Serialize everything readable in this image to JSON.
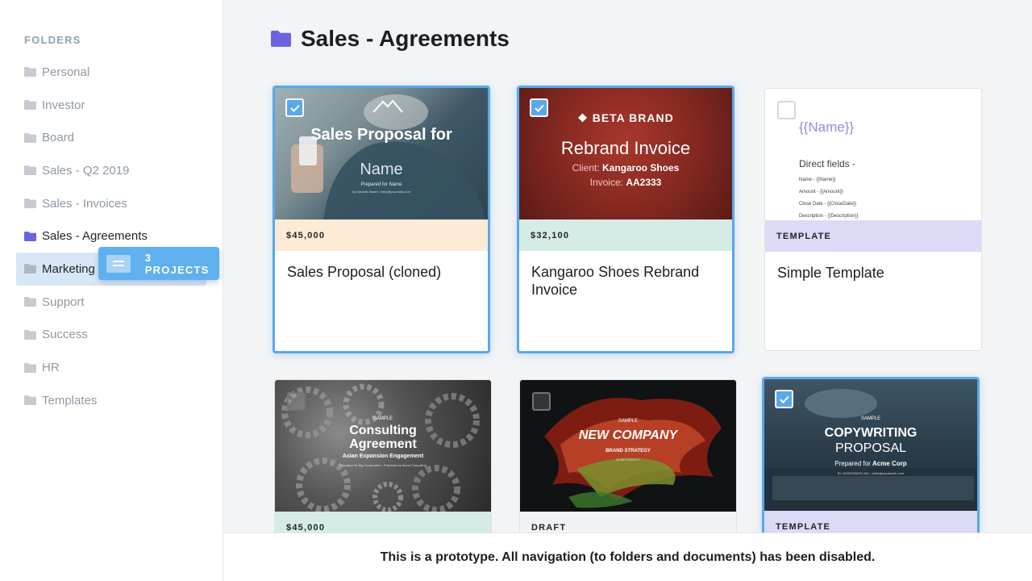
{
  "sidebar": {
    "heading": "FOLDERS",
    "folders": [
      {
        "label": "Personal"
      },
      {
        "label": "Investor"
      },
      {
        "label": "Board"
      },
      {
        "label": "Sales - Q2 2019"
      },
      {
        "label": "Sales - Invoices"
      },
      {
        "label": "Sales - Agreements"
      },
      {
        "label": "Marketing"
      },
      {
        "label": "Support"
      },
      {
        "label": "Success"
      },
      {
        "label": "HR"
      },
      {
        "label": "Templates"
      }
    ],
    "active_folder": "Sales - Agreements",
    "drop_target_folder": "Marketing"
  },
  "drag_badge": {
    "label": "3 PROJECTS"
  },
  "main": {
    "title": "Sales - Agreements",
    "cards": [
      {
        "band": "$45,000",
        "title": "Sales Proposal (cloned)",
        "selected": true,
        "thumb": {
          "line1": "Sales Proposal for",
          "line2": "Name",
          "line3": "Prepared for Name",
          "line4": "by Danielle Baker • hello@proposify.com"
        }
      },
      {
        "band": "$32,100",
        "title": "Kangaroo Shoes Rebrand Invoice",
        "selected": true,
        "thumb": {
          "brand": "BETA BRAND",
          "line1": "Rebrand Invoice",
          "client_label": "Client:",
          "client": "Kangaroo Shoes",
          "invoice_label": "Invoice:",
          "invoice": "AA2333"
        }
      },
      {
        "band": "TEMPLATE",
        "title": "Simple Template",
        "selected": false,
        "thumb": {
          "name_tag": "{{Name}}",
          "heading": "Direct fields -",
          "fields": [
            "Name - {{Name}}",
            "Amount - {{Amount}}",
            "Close Date - {{CloseDate}}",
            "Description - {{Description}}"
          ]
        }
      },
      {
        "band": "$45,000",
        "title": "",
        "selected": false,
        "thumb": {
          "sample": "SAMPLE",
          "line1": "Consulting",
          "line2": "Agreement",
          "line3": "Asian Expansion Engagement",
          "line4": "Prepared for Big Corporation  •  Prepared by Acme Consulting"
        }
      },
      {
        "band": "DRAFT",
        "title": "",
        "selected": false,
        "thumb": {
          "sample": "SAMPLE",
          "line1": "NEW COMPANY",
          "line2": "BRAND STRATEGY",
          "line3": "ACME AGENCY"
        }
      },
      {
        "band": "TEMPLATE",
        "title": "",
        "selected": true,
        "thumb": {
          "sample": "SAMPLE",
          "line1": "COPYWRITING",
          "line2": "PROPOSAL",
          "line3_label": "Prepared for",
          "line3": "Acme Corp",
          "line4": "BY WORDSMITH INC  •  hello@wordsmith.com"
        }
      }
    ]
  },
  "footer": {
    "text": "This is a prototype. All navigation (to folders and documents) has been disabled."
  },
  "colors": {
    "accent": "#5aa8ea",
    "folder_active": "#6c63e0",
    "band_peach": "#fdebd6",
    "band_mint": "#d5ebe6",
    "band_lavender": "#dcdaf7",
    "band_gray": "#f1f2f4",
    "drop_highlight": "#d9e6f5"
  }
}
